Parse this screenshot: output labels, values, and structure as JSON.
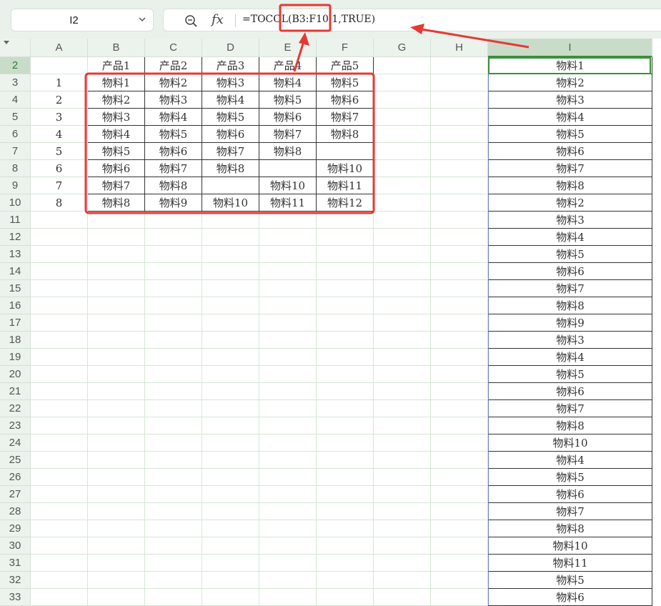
{
  "name_box": {
    "value": "I2"
  },
  "formula_bar": {
    "fx_label": "fx",
    "formula": "=TOCOL(B3:F10,1,TRUE)"
  },
  "columns": [
    "A",
    "B",
    "C",
    "D",
    "E",
    "F",
    "G",
    "H",
    "I"
  ],
  "selected_column": "I",
  "rows": [
    2,
    3,
    4,
    5,
    6,
    7,
    8,
    9,
    10,
    11,
    12,
    13,
    14,
    15,
    16,
    17,
    18,
    19,
    20,
    21,
    22,
    23,
    24,
    25,
    26,
    27,
    28,
    29,
    30,
    31,
    32,
    33
  ],
  "selected_row": 2,
  "table": {
    "headers": [
      "",
      "产品1",
      "产品2",
      "产品3",
      "产品4",
      "产品5"
    ],
    "rows": [
      [
        "1",
        "物料1",
        "物料2",
        "物料3",
        "物料4",
        "物料5"
      ],
      [
        "2",
        "物料2",
        "物料3",
        "物料4",
        "物料5",
        "物料6"
      ],
      [
        "3",
        "物料3",
        "物料4",
        "物料5",
        "物料6",
        "物料7"
      ],
      [
        "4",
        "物料4",
        "物料5",
        "物料6",
        "物料7",
        "物料8"
      ],
      [
        "5",
        "物料5",
        "物料6",
        "物料7",
        "物料8",
        ""
      ],
      [
        "6",
        "物料6",
        "物料7",
        "物料8",
        "",
        "物料10"
      ],
      [
        "7",
        "物料7",
        "物料8",
        "",
        "物料10",
        "物料11"
      ],
      [
        "8",
        "物料8",
        "物料9",
        "物料10",
        "物料11",
        "物料12"
      ]
    ]
  },
  "result_column": [
    "物料1",
    "物料2",
    "物料3",
    "物料4",
    "物料5",
    "物料6",
    "物料7",
    "物料8",
    "物料2",
    "物料3",
    "物料4",
    "物料5",
    "物料6",
    "物料7",
    "物料8",
    "物料9",
    "物料3",
    "物料4",
    "物料5",
    "物料6",
    "物料7",
    "物料8",
    "物料10",
    "物料4",
    "物料5",
    "物料6",
    "物料7",
    "物料8",
    "物料10",
    "物料11",
    "物料5",
    "物料6"
  ],
  "colors": {
    "annotation": "#e53935",
    "selection": "#3a8f3a",
    "header_bg": "#ecf2ec"
  },
  "icons": {
    "zoom": "zoom-out-icon",
    "dropdown": "chevron-down-icon",
    "filter_corner": "select-all-triangle-icon"
  }
}
